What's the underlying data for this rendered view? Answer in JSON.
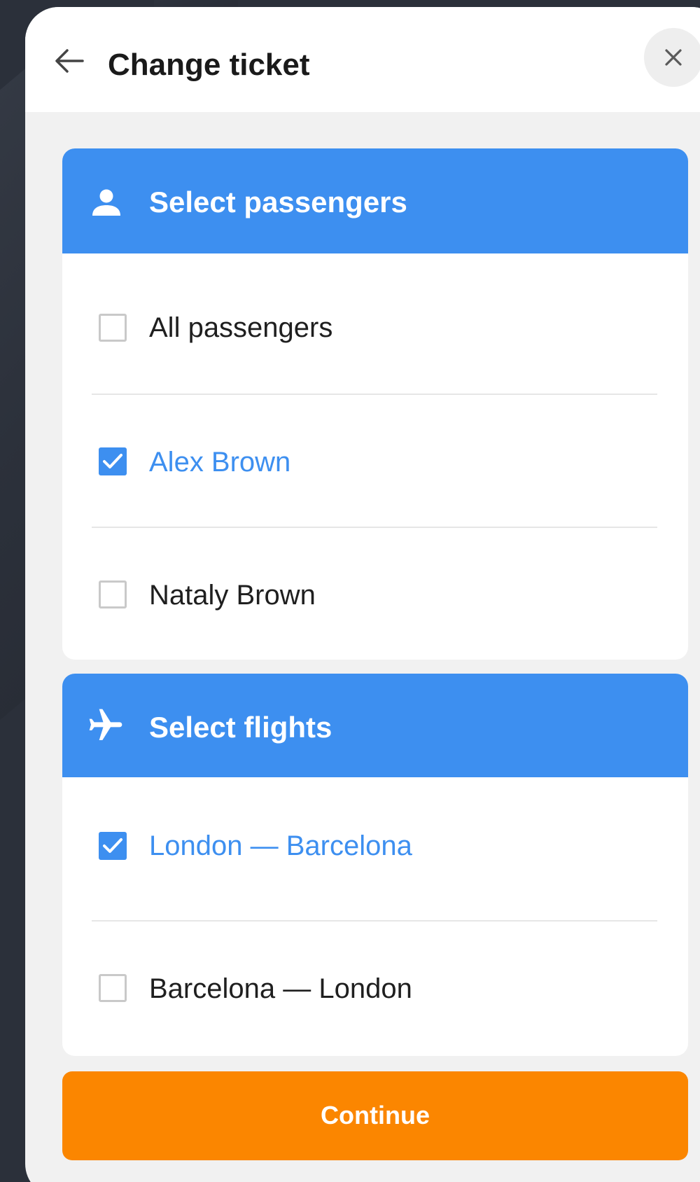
{
  "header": {
    "title": "Change ticket",
    "back_icon": "arrow-left-icon",
    "close_icon": "close-icon"
  },
  "passengers": {
    "title": "Select passengers",
    "icon": "person-icon",
    "items": [
      {
        "label": "All passengers",
        "checked": false
      },
      {
        "label": "Alex Brown",
        "checked": true
      },
      {
        "label": "Nataly Brown",
        "checked": false
      }
    ]
  },
  "flights": {
    "title": "Select flights",
    "icon": "airplane-icon",
    "items": [
      {
        "label": "London — Barcelona",
        "checked": true
      },
      {
        "label": "Barcelona — London",
        "checked": false
      }
    ]
  },
  "actions": {
    "continue_label": "Continue"
  },
  "colors": {
    "accent": "#3d8ff0",
    "primary_button": "#fb8600",
    "text": "#1f1f1f",
    "background": "#f1f1f1"
  }
}
